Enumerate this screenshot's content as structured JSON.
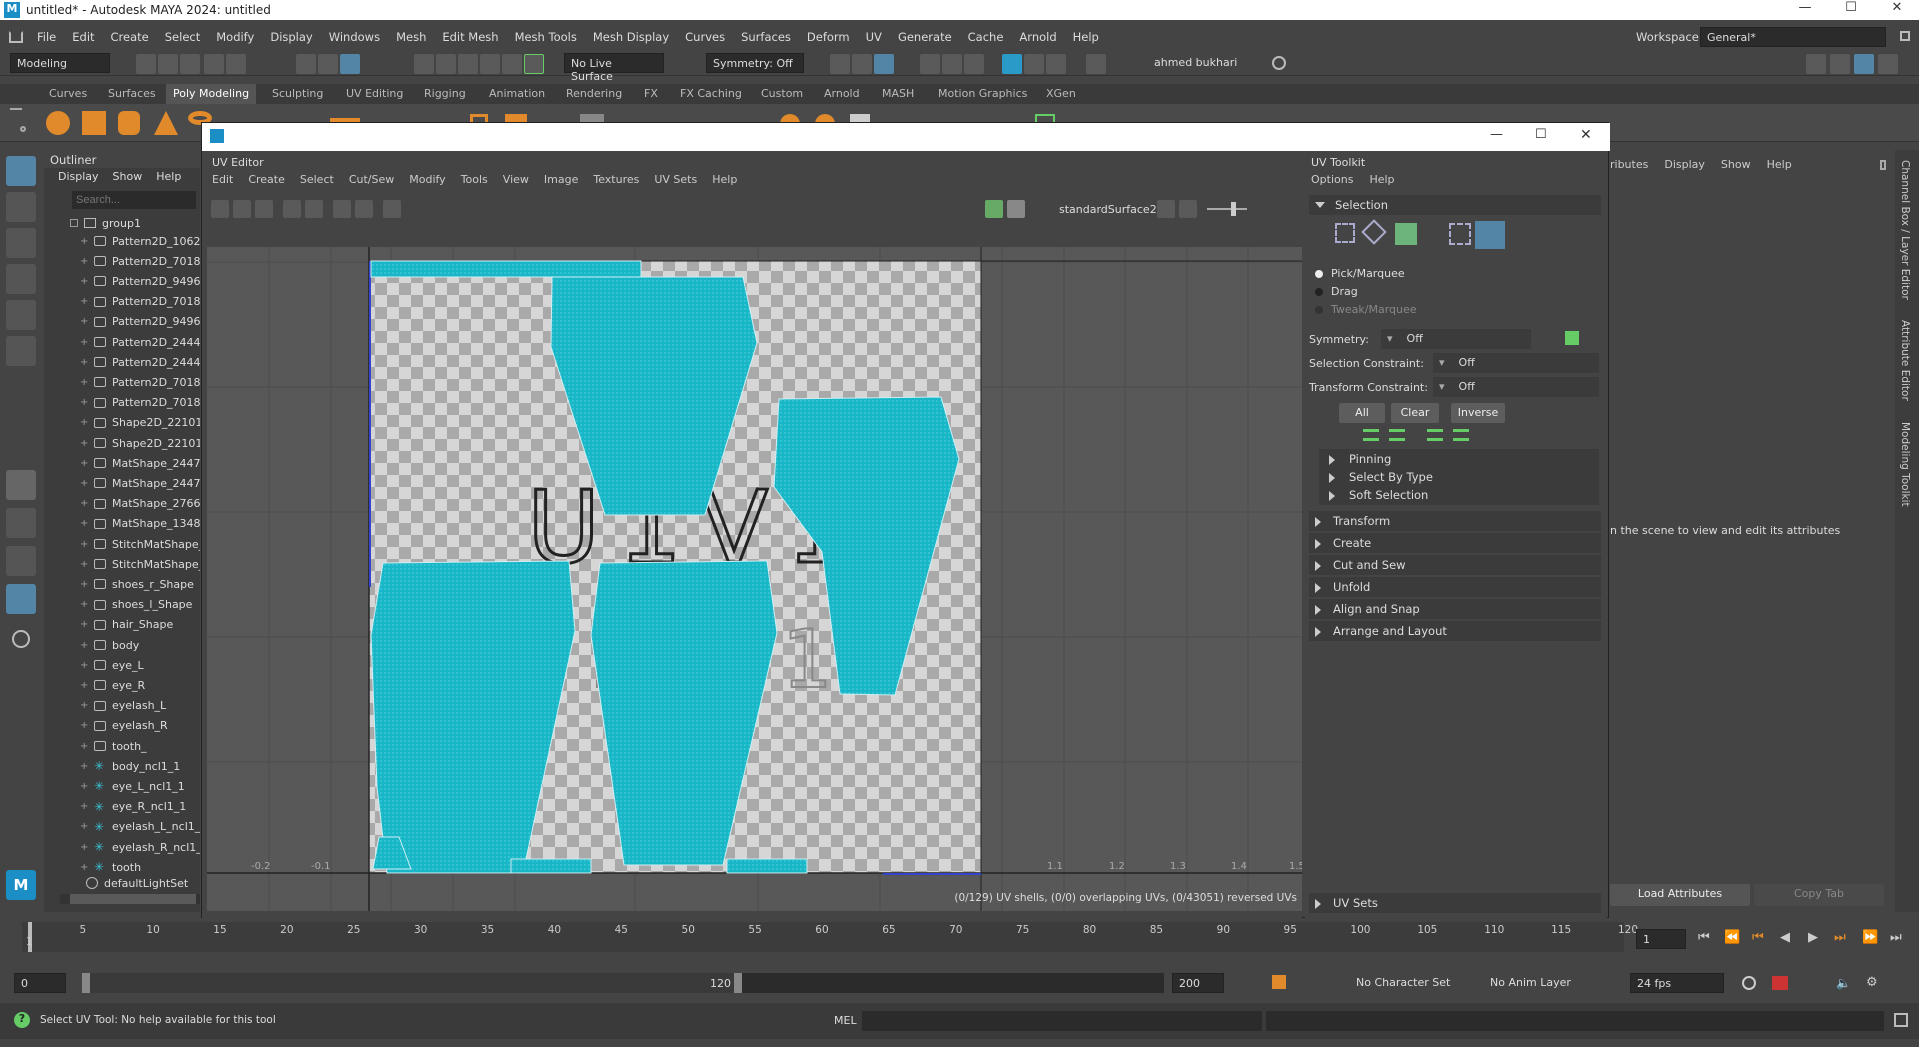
{
  "window_title": "untitled* - Autodesk MAYA 2024: untitled",
  "menu": [
    "File",
    "Edit",
    "Create",
    "Select",
    "Modify",
    "Display",
    "Windows",
    "Mesh",
    "Edit Mesh",
    "Mesh Tools",
    "Mesh Display",
    "Curves",
    "Surfaces",
    "Deform",
    "UV",
    "Generate",
    "Cache",
    "Arnold",
    "Help"
  ],
  "workspace_label": "Workspace:",
  "workspace_value": "General*",
  "mode_menu": "Modeling",
  "live_surface": "No Live Surface",
  "symmetry_status": "Symmetry: Off",
  "user_name": "ahmed bukhari",
  "shelf_tabs": [
    "Curves",
    "Surfaces",
    "Poly Modeling",
    "Sculpting",
    "UV Editing",
    "Rigging",
    "Animation",
    "Rendering",
    "FX",
    "FX Caching",
    "Custom",
    "Arnold",
    "MASH",
    "Motion Graphics",
    "XGen"
  ],
  "active_shelf_tab": "Poly Modeling",
  "outliner": {
    "title": "Outliner",
    "menus": [
      "Display",
      "Show",
      "Help"
    ],
    "search_placeholder": "Search...",
    "group": "group1",
    "items": [
      {
        "label": "Pattern2D_1062",
        "type": "mesh"
      },
      {
        "label": "Pattern2D_7018",
        "type": "mesh"
      },
      {
        "label": "Pattern2D_9496",
        "type": "mesh"
      },
      {
        "label": "Pattern2D_7018",
        "type": "mesh"
      },
      {
        "label": "Pattern2D_9496",
        "type": "mesh"
      },
      {
        "label": "Pattern2D_2444",
        "type": "mesh"
      },
      {
        "label": "Pattern2D_2444",
        "type": "mesh"
      },
      {
        "label": "Pattern2D_7018",
        "type": "mesh"
      },
      {
        "label": "Pattern2D_7018",
        "type": "mesh"
      },
      {
        "label": "Shape2D_22101",
        "type": "mesh"
      },
      {
        "label": "Shape2D_22101",
        "type": "mesh"
      },
      {
        "label": "MatShape_2447",
        "type": "mesh"
      },
      {
        "label": "MatShape_2447",
        "type": "mesh"
      },
      {
        "label": "MatShape_2766",
        "type": "mesh"
      },
      {
        "label": "MatShape_1348",
        "type": "mesh"
      },
      {
        "label": "StitchMatShape_",
        "type": "mesh"
      },
      {
        "label": "StitchMatShape_",
        "type": "mesh"
      },
      {
        "label": "shoes_r_Shape",
        "type": "mesh"
      },
      {
        "label": "shoes_l_Shape",
        "type": "mesh"
      },
      {
        "label": "hair_Shape",
        "type": "mesh"
      },
      {
        "label": "body",
        "type": "mesh"
      },
      {
        "label": "eye_L",
        "type": "mesh"
      },
      {
        "label": "eye_R",
        "type": "mesh"
      },
      {
        "label": "eyelash_L",
        "type": "mesh"
      },
      {
        "label": "eyelash_R",
        "type": "mesh"
      },
      {
        "label": "tooth_",
        "type": "mesh"
      },
      {
        "label": "body_ncl1_1",
        "type": "joint"
      },
      {
        "label": "eye_L_ncl1_1",
        "type": "joint"
      },
      {
        "label": "eye_R_ncl1_1",
        "type": "joint"
      },
      {
        "label": "eyelash_L_ncl1_1",
        "type": "joint"
      },
      {
        "label": "eyelash_R_ncl1_",
        "type": "joint"
      },
      {
        "label": "tooth",
        "type": "joint"
      }
    ],
    "default_set": "defaultLightSet"
  },
  "uv_editor": {
    "title": "UV Editor",
    "menus": [
      "Edit",
      "Create",
      "Select",
      "Cut/Sew",
      "Modify",
      "Tools",
      "View",
      "Image",
      "Textures",
      "UV Sets",
      "Help"
    ],
    "material": "standardSurface2",
    "tile_label_1": "U1V1",
    "tile_label_2": "1001",
    "status": "(0/129) UV shells, (0/0) overlapping UVs, (0/43051) reversed UVs",
    "axis_ticks": [
      "-0.2",
      "-0.1",
      "1.1",
      "1.2",
      "1.3",
      "1.4",
      "1.5"
    ]
  },
  "toolkit": {
    "title": "UV Toolkit",
    "menus": [
      "Options",
      "Help"
    ],
    "selection_header": "Selection",
    "modes": [
      "Pick/Marquee",
      "Drag",
      "Tweak/Marquee"
    ],
    "symmetry_label": "Symmetry:",
    "symmetry_value": "Off",
    "sel_constraint_label": "Selection Constraint:",
    "sel_constraint_value": "Off",
    "xform_constraint_label": "Transform Constraint:",
    "xform_constraint_value": "Off",
    "buttons": [
      "All",
      "Clear",
      "Inverse"
    ],
    "sub_sections": [
      "Pinning",
      "Select By Type",
      "Soft Selection"
    ],
    "sections": [
      "Transform",
      "Create",
      "Cut and Sew",
      "Unfold",
      "Align and Snap",
      "Arrange and Layout"
    ],
    "uv_sets": "UV Sets"
  },
  "attr_editor": {
    "menus": [
      "ributes",
      "Display",
      "Show",
      "Help"
    ],
    "hint": "n the scene to view and edit its attributes",
    "load_btn": "Load Attributes",
    "copy_btn": "Copy Tab"
  },
  "side_tabs": [
    "Channel Box / Layer Editor",
    "Attribute Editor",
    "Modeling Toolkit"
  ],
  "timeline": {
    "ticks": [
      "1",
      "5",
      "10",
      "15",
      "20",
      "25",
      "30",
      "35",
      "40",
      "45",
      "50",
      "55",
      "60",
      "65",
      "70",
      "75",
      "80",
      "85",
      "90",
      "95",
      "100",
      "105",
      "110",
      "115",
      "120"
    ],
    "current_frame": "1",
    "range_start": "0",
    "range_inner_start": "1",
    "range_inner_end": "120",
    "range_end": "200",
    "character_set": "No Character Set",
    "anim_layer": "No Anim Layer",
    "fps": "24 fps"
  },
  "help_line": "Select UV Tool: No help available for this tool",
  "mel_label": "MEL",
  "colors": {
    "uv_shell": "#17b7c8",
    "accent": "#5285a6",
    "bg": "#444444"
  }
}
